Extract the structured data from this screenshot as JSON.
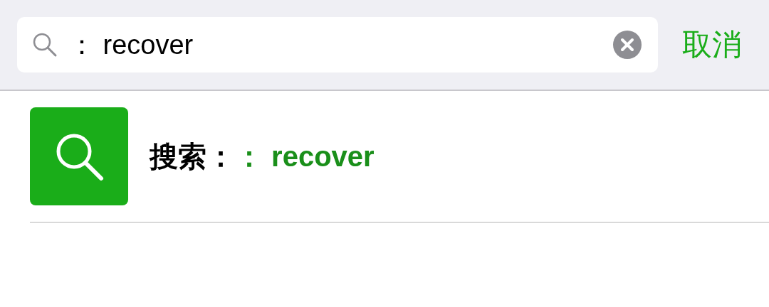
{
  "search_bar": {
    "value": "： recover",
    "cancel": "取消"
  },
  "results": [
    {
      "label": "搜索：",
      "query": "： recover"
    }
  ]
}
